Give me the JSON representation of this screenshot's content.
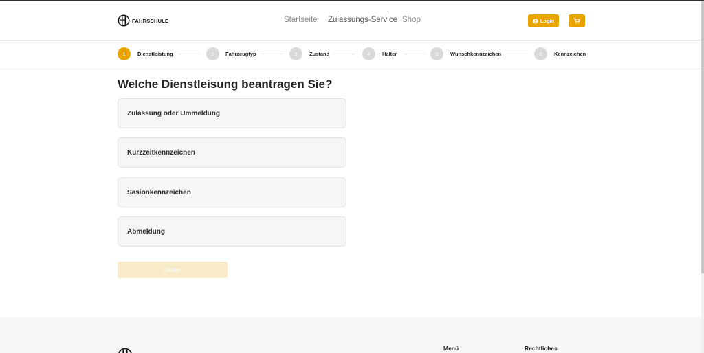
{
  "header": {
    "logo_text": "FAHRSCHULE",
    "nav": [
      "Startseite",
      "Zulassungs-Service",
      "Shop"
    ],
    "login_label": "Login",
    "icons": {
      "user": "user-circle-icon",
      "cart": "cart-icon"
    },
    "accent": "#e9a400"
  },
  "stepper": {
    "steps": [
      {
        "num": "1",
        "label": "Dienstleistung"
      },
      {
        "num": "2",
        "label": "Fahrzeugtyp"
      },
      {
        "num": "3",
        "label": "Zustand"
      },
      {
        "num": "4",
        "label": "Halter"
      },
      {
        "num": "5",
        "label": "Wunschkennzeichen"
      },
      {
        "num": "6",
        "label": "Kennzeichen"
      }
    ],
    "active": "1"
  },
  "main": {
    "question": "Welche Dienstleisung beantragen Sie?",
    "options": [
      "Zulassung oder Ummeldung",
      "Kurzzeitkennzeichen",
      "Sasionkennzeichen",
      "Abmeldung"
    ],
    "next_label": "Weiter"
  },
  "footer": {
    "col1": "Menü",
    "col2": "Rechtliches"
  }
}
